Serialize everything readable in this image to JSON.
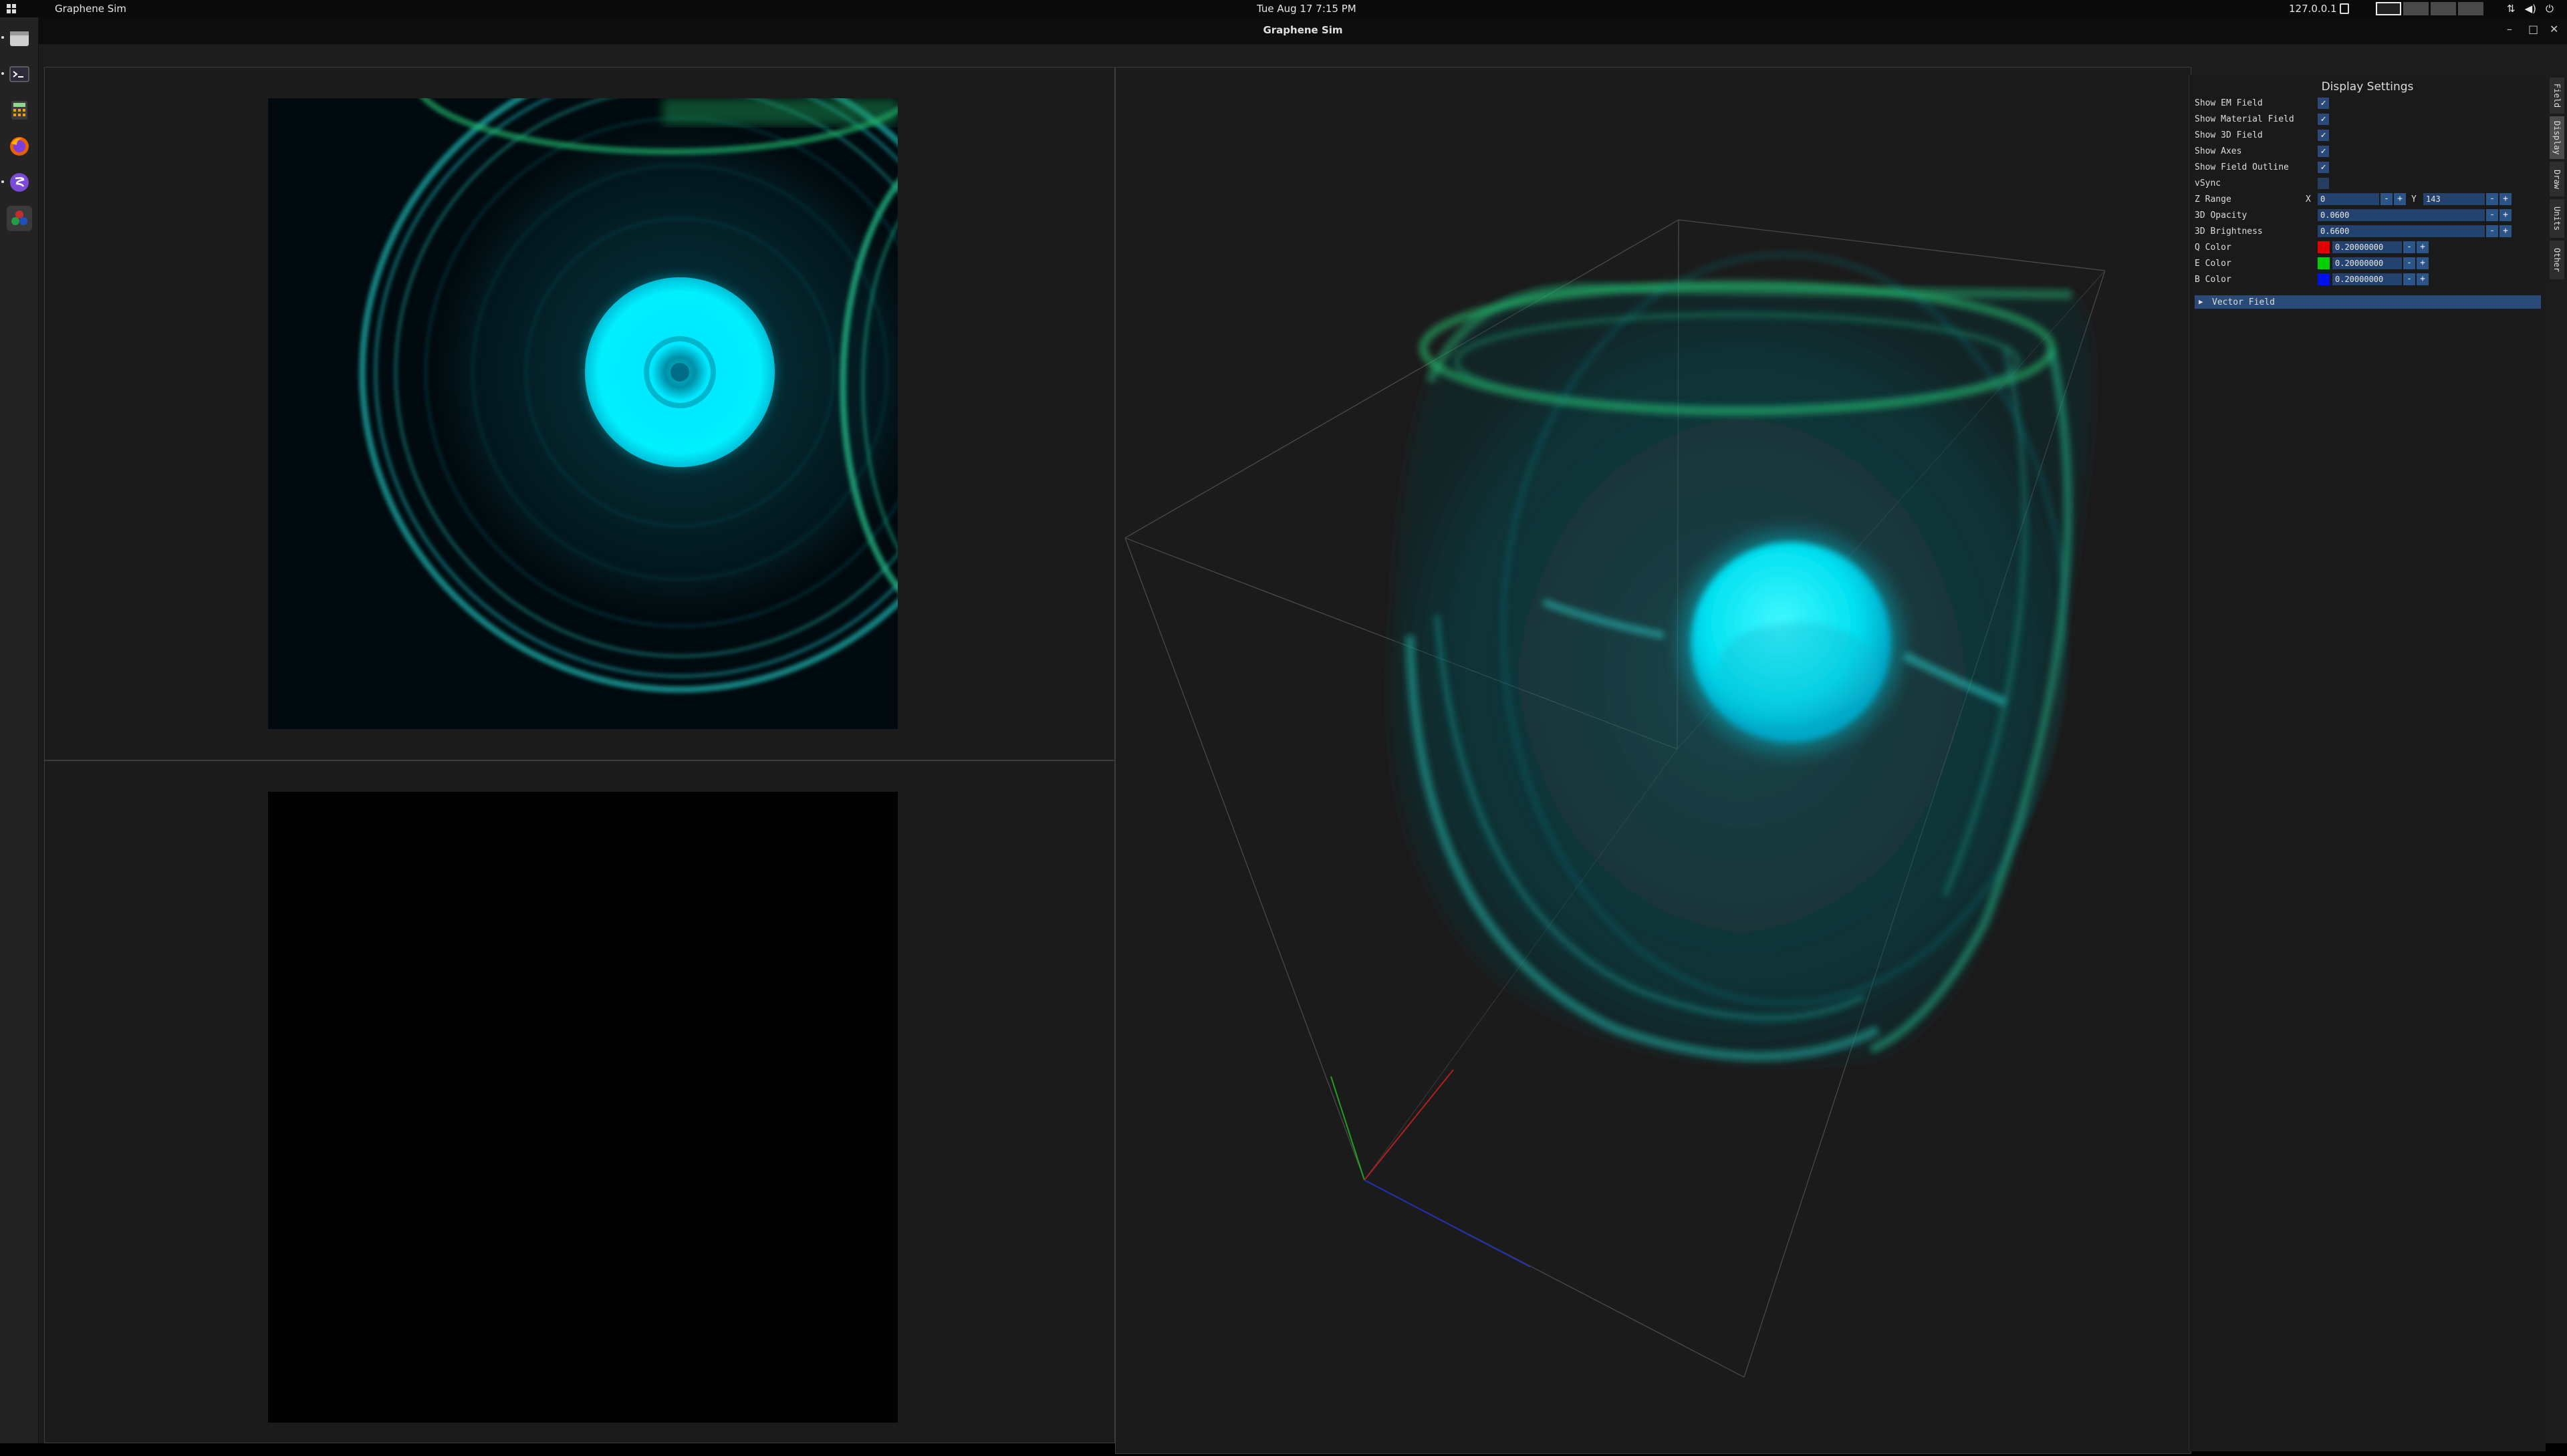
{
  "topbar": {
    "app_name": "Graphene Sim",
    "clock": "Tue Aug 17   7:15 PM",
    "ip": "127.0.0.1"
  },
  "window": {
    "title": "Graphene Sim",
    "minimize": "–",
    "maximize": "□",
    "close": "✕"
  },
  "settings": {
    "heading": "Display Settings",
    "checkboxes": [
      {
        "label": "Show EM Field",
        "checked": true
      },
      {
        "label": "Show Material Field",
        "checked": true
      },
      {
        "label": "Show 3D Field",
        "checked": true
      },
      {
        "label": "Show Axes",
        "checked": true
      },
      {
        "label": "Show Field Outline",
        "checked": true
      },
      {
        "label": "vSync",
        "checked": false
      }
    ],
    "z_range": {
      "label": "Z Range",
      "x_label": "X",
      "x_value": "0",
      "y_label": "Y",
      "y_value": "143"
    },
    "opacity": {
      "label": "3D Opacity",
      "value": "0.0600"
    },
    "brightness": {
      "label": "3D Brightness",
      "value": "0.6600"
    },
    "colors": [
      {
        "label": "Q Color",
        "swatch": "#e00000",
        "value": "0.20000000"
      },
      {
        "label": "E Color",
        "swatch": "#00d000",
        "value": "0.20000000"
      },
      {
        "label": "B Color",
        "swatch": "#0010e8",
        "value": "0.20000000"
      }
    ],
    "minus": "-",
    "plus": "+",
    "check_mark": "✓",
    "vector_field": {
      "arrow": "▶",
      "label": "Vector Field"
    }
  },
  "tabs": [
    "Field",
    "Display",
    "Draw",
    "Units",
    "Other"
  ],
  "tab_active": "Display"
}
